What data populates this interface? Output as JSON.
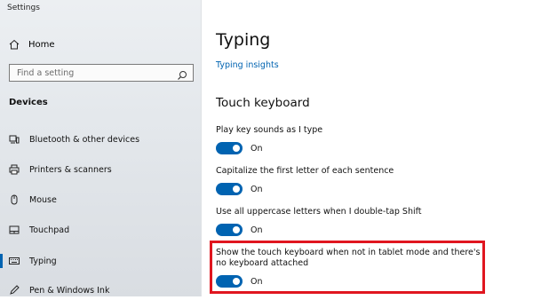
{
  "window": {
    "title": "Settings"
  },
  "sidebar": {
    "home_label": "Home",
    "search_placeholder": "Find a setting",
    "section_label": "Devices",
    "items": [
      {
        "label": "Bluetooth & other devices",
        "icon": "bluetooth-devices-icon"
      },
      {
        "label": "Printers & scanners",
        "icon": "printer-icon"
      },
      {
        "label": "Mouse",
        "icon": "mouse-icon"
      },
      {
        "label": "Touchpad",
        "icon": "touchpad-icon"
      },
      {
        "label": "Typing",
        "icon": "keyboard-icon",
        "active": true
      },
      {
        "label": "Pen & Windows Ink",
        "icon": "pen-icon"
      }
    ]
  },
  "main": {
    "title": "Typing",
    "insights_link": "Typing insights",
    "section_heading": "Touch keyboard",
    "settings": [
      {
        "label": "Play key sounds as I type",
        "state": "On"
      },
      {
        "label": "Capitalize the first letter of each sentence",
        "state": "On"
      },
      {
        "label": "Use all uppercase letters when I double-tap Shift",
        "state": "On"
      },
      {
        "label": "Show the touch keyboard when not in tablet mode and there's no keyboard attached",
        "state": "On",
        "highlighted": true
      }
    ]
  },
  "colors": {
    "accent": "#0063b1",
    "highlight": "#e0161f"
  }
}
